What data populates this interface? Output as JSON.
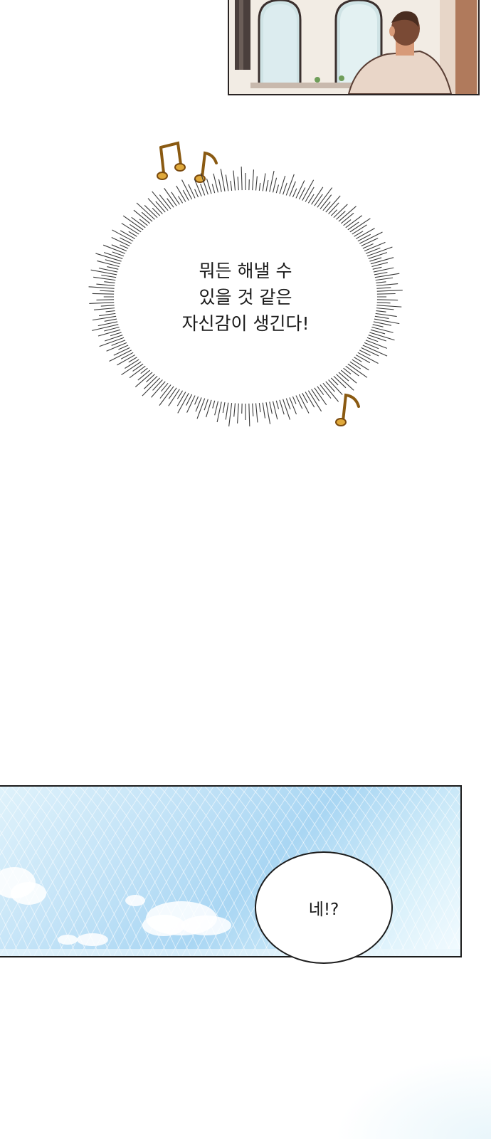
{
  "burst_bubble": {
    "lines": [
      "뭐든 해낼 수",
      "있을 것 같은",
      "자신감이 생긴다!"
    ]
  },
  "speech_bubble": {
    "text": "네!?"
  },
  "icons": [
    "music-note-icon",
    "music-note-icon",
    "music-note-icon"
  ],
  "colors": {
    "note": "#8a5a12",
    "burst_line": "#3a3a3a",
    "sky": "#a9d6f3"
  }
}
